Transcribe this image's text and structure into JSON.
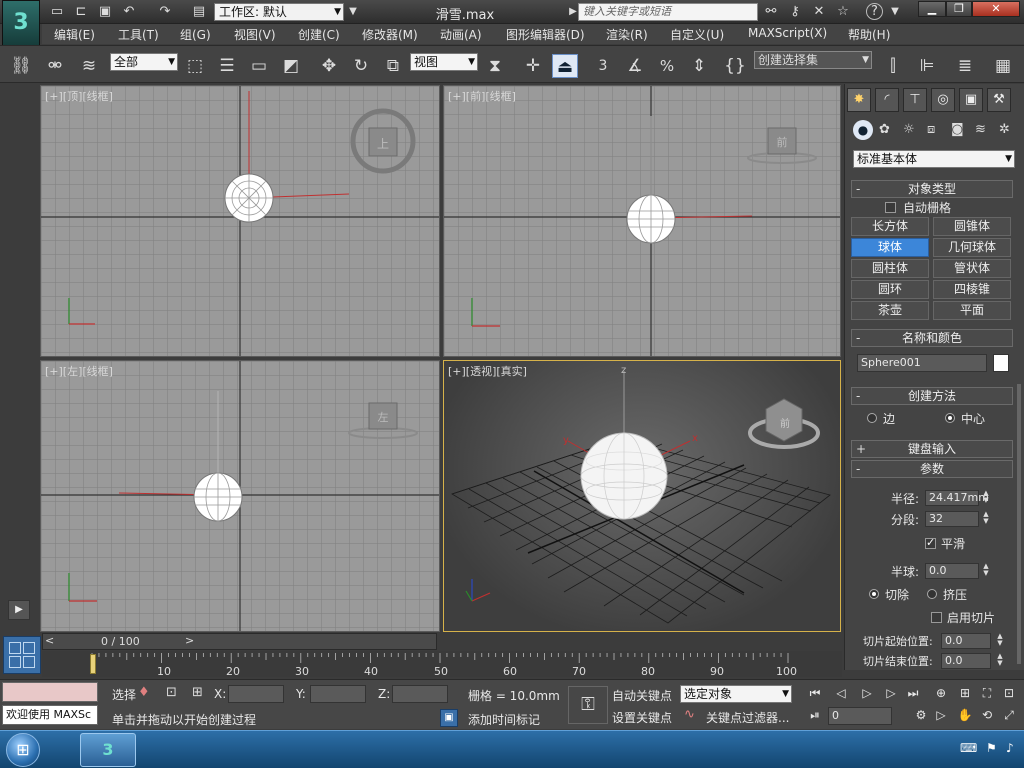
{
  "titlebar": {
    "app_logo": "3",
    "workspace": "工作区: 默认",
    "doc_title": "滑雪.max",
    "search_placeholder": "键入关键字或短语",
    "help": "?"
  },
  "menu": [
    "编辑(E)",
    "工具(T)",
    "组(G)",
    "视图(V)",
    "创建(C)",
    "修改器(M)",
    "动画(A)",
    "图形编辑器(D)",
    "渲染(R)",
    "自定义(U)",
    "MAXScript(X)",
    "帮助(H)"
  ],
  "toolbar": {
    "selection_filter": "全部",
    "ref_coord": "视图",
    "named_selection": "创建选择集",
    "snap_label": "3",
    "percent_label": "%"
  },
  "viewports": {
    "top": "[+][顶][线框]",
    "front": "[+][前][线框]",
    "left": "[+][左][线框]",
    "persp": "[+][透视][真实]",
    "top_cube": "上",
    "front_cube": "前",
    "left_cube": "左",
    "persp_cube": "前",
    "axis_x": "x",
    "axis_y": "y",
    "axis_z": "z"
  },
  "panel": {
    "category": "标准基本体",
    "object_type": {
      "title": "对象类型",
      "auto_grid": "自动栅格",
      "buttons": [
        "长方体",
        "圆锥体",
        "球体",
        "几何球体",
        "圆柱体",
        "管状体",
        "圆环",
        "四棱锥",
        "茶壶",
        "平面"
      ]
    },
    "name_color": {
      "title": "名称和颜色",
      "name": "Sphere001"
    },
    "creation_method": {
      "title": "创建方法",
      "edge": "边",
      "center": "中心"
    },
    "keyboard_entry": "键盘输入",
    "params": {
      "title": "参数",
      "radius_label": "半径:",
      "radius": "24.417mm",
      "segments_label": "分段:",
      "segments": "32",
      "smooth": "平滑",
      "hemisphere_label": "半球:",
      "hemisphere": "0.0",
      "chop": "切除",
      "squash": "挤压",
      "slice_on": "启用切片",
      "slice_from_label": "切片起始位置:",
      "slice_from": "0.0",
      "slice_to_label": "切片结束位置:",
      "slice_to": "0.0"
    }
  },
  "timeline": {
    "frame": "0 / 100",
    "ticks": [
      "0",
      "10",
      "20",
      "30",
      "40",
      "50",
      "60",
      "70",
      "80",
      "90",
      "100"
    ]
  },
  "status": {
    "welcome": "欢迎使用 MAXSc",
    "select_label": "选择",
    "x_label": "X:",
    "y_label": "Y:",
    "z_label": "Z:",
    "grid": "栅格 = 10.0mm",
    "prompt": "单击并拖动以开始创建过程",
    "add_time_tag": "添加时间标记",
    "auto_key": "自动关键点",
    "set_key": "设置关键点",
    "key_target": "选定对象",
    "key_filters": "关键点过滤器...",
    "frame_field": "0"
  }
}
